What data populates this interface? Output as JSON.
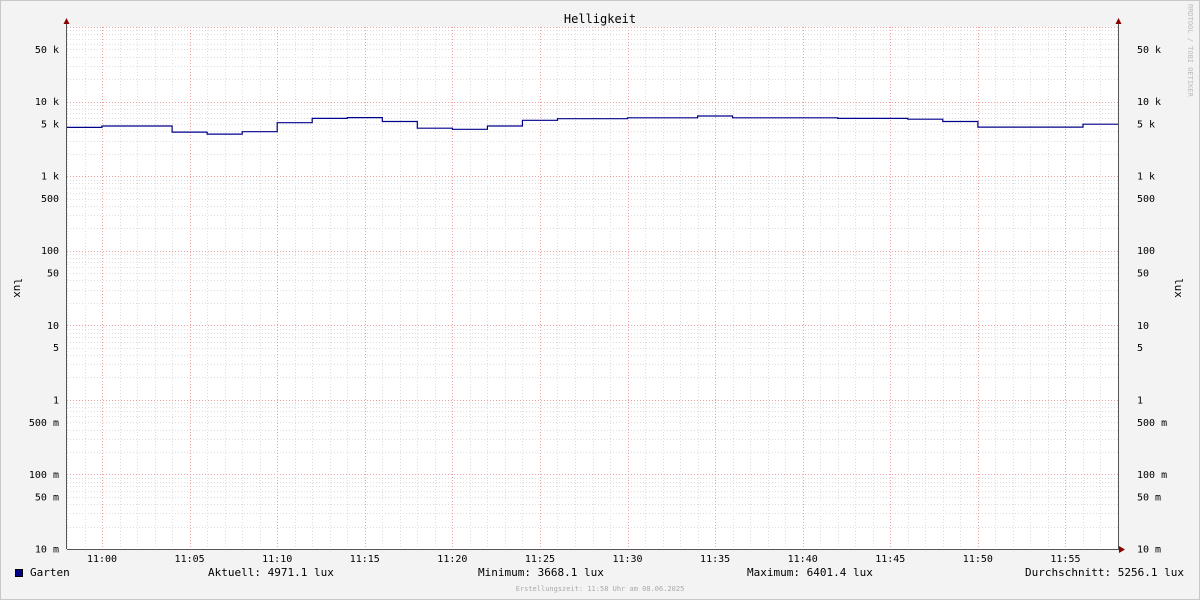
{
  "watermark": "RRDTOOL / TOBI OETIKER",
  "footer": "Erstellungszeit: 11:58 Uhr am 08.06.2025",
  "legend": {
    "series_name": "Garten",
    "series_color": "#00008b",
    "current": "Aktuell: 4971.1 lux",
    "minimum": "Minimum: 3668.1 lux",
    "maximum": "Maximum: 6401.4 lux",
    "average": "Durchschnitt: 5256.1 lux"
  },
  "chart_data": {
    "type": "line",
    "title": "Helligkeit",
    "ylabel": "lux",
    "y_scale": "log",
    "ylim": [
      0.01,
      100000
    ],
    "xlim": [
      "10:58",
      "11:58"
    ],
    "grid": true,
    "y_ticks": [
      {
        "value": 50000,
        "label": "50 k"
      },
      {
        "value": 10000,
        "label": "10 k"
      },
      {
        "value": 5000,
        "label": "5 k"
      },
      {
        "value": 1000,
        "label": "1 k"
      },
      {
        "value": 500,
        "label": "500"
      },
      {
        "value": 100,
        "label": "100"
      },
      {
        "value": 50,
        "label": "50"
      },
      {
        "value": 10,
        "label": "10"
      },
      {
        "value": 5,
        "label": "5"
      },
      {
        "value": 1,
        "label": "1"
      },
      {
        "value": 0.5,
        "label": "500 m"
      },
      {
        "value": 0.1,
        "label": "100 m"
      },
      {
        "value": 0.05,
        "label": "50 m"
      },
      {
        "value": 0.01,
        "label": "10 m"
      }
    ],
    "x_ticks": [
      "11:00",
      "11:05",
      "11:10",
      "11:15",
      "11:20",
      "11:25",
      "11:30",
      "11:35",
      "11:40",
      "11:45",
      "11:50",
      "11:55"
    ],
    "series": [
      {
        "name": "Garten",
        "color": "#00008b",
        "steps": [
          {
            "start": "10:58",
            "value": 4500
          },
          {
            "start": "11:00",
            "value": 4700
          },
          {
            "start": "11:04",
            "value": 3900
          },
          {
            "start": "11:06",
            "value": 3668.1
          },
          {
            "start": "11:08",
            "value": 3950
          },
          {
            "start": "11:10",
            "value": 5200
          },
          {
            "start": "11:12",
            "value": 5950
          },
          {
            "start": "11:14",
            "value": 6100
          },
          {
            "start": "11:16",
            "value": 5400
          },
          {
            "start": "11:18",
            "value": 4400
          },
          {
            "start": "11:20",
            "value": 4250
          },
          {
            "start": "11:22",
            "value": 4700
          },
          {
            "start": "11:24",
            "value": 5600
          },
          {
            "start": "11:26",
            "value": 5900
          },
          {
            "start": "11:30",
            "value": 6050
          },
          {
            "start": "11:34",
            "value": 6401.4
          },
          {
            "start": "11:36",
            "value": 6050
          },
          {
            "start": "11:42",
            "value": 5950
          },
          {
            "start": "11:46",
            "value": 5800
          },
          {
            "start": "11:48",
            "value": 5400
          },
          {
            "start": "11:50",
            "value": 4550
          },
          {
            "start": "11:56",
            "value": 4971.1
          }
        ]
      }
    ]
  }
}
